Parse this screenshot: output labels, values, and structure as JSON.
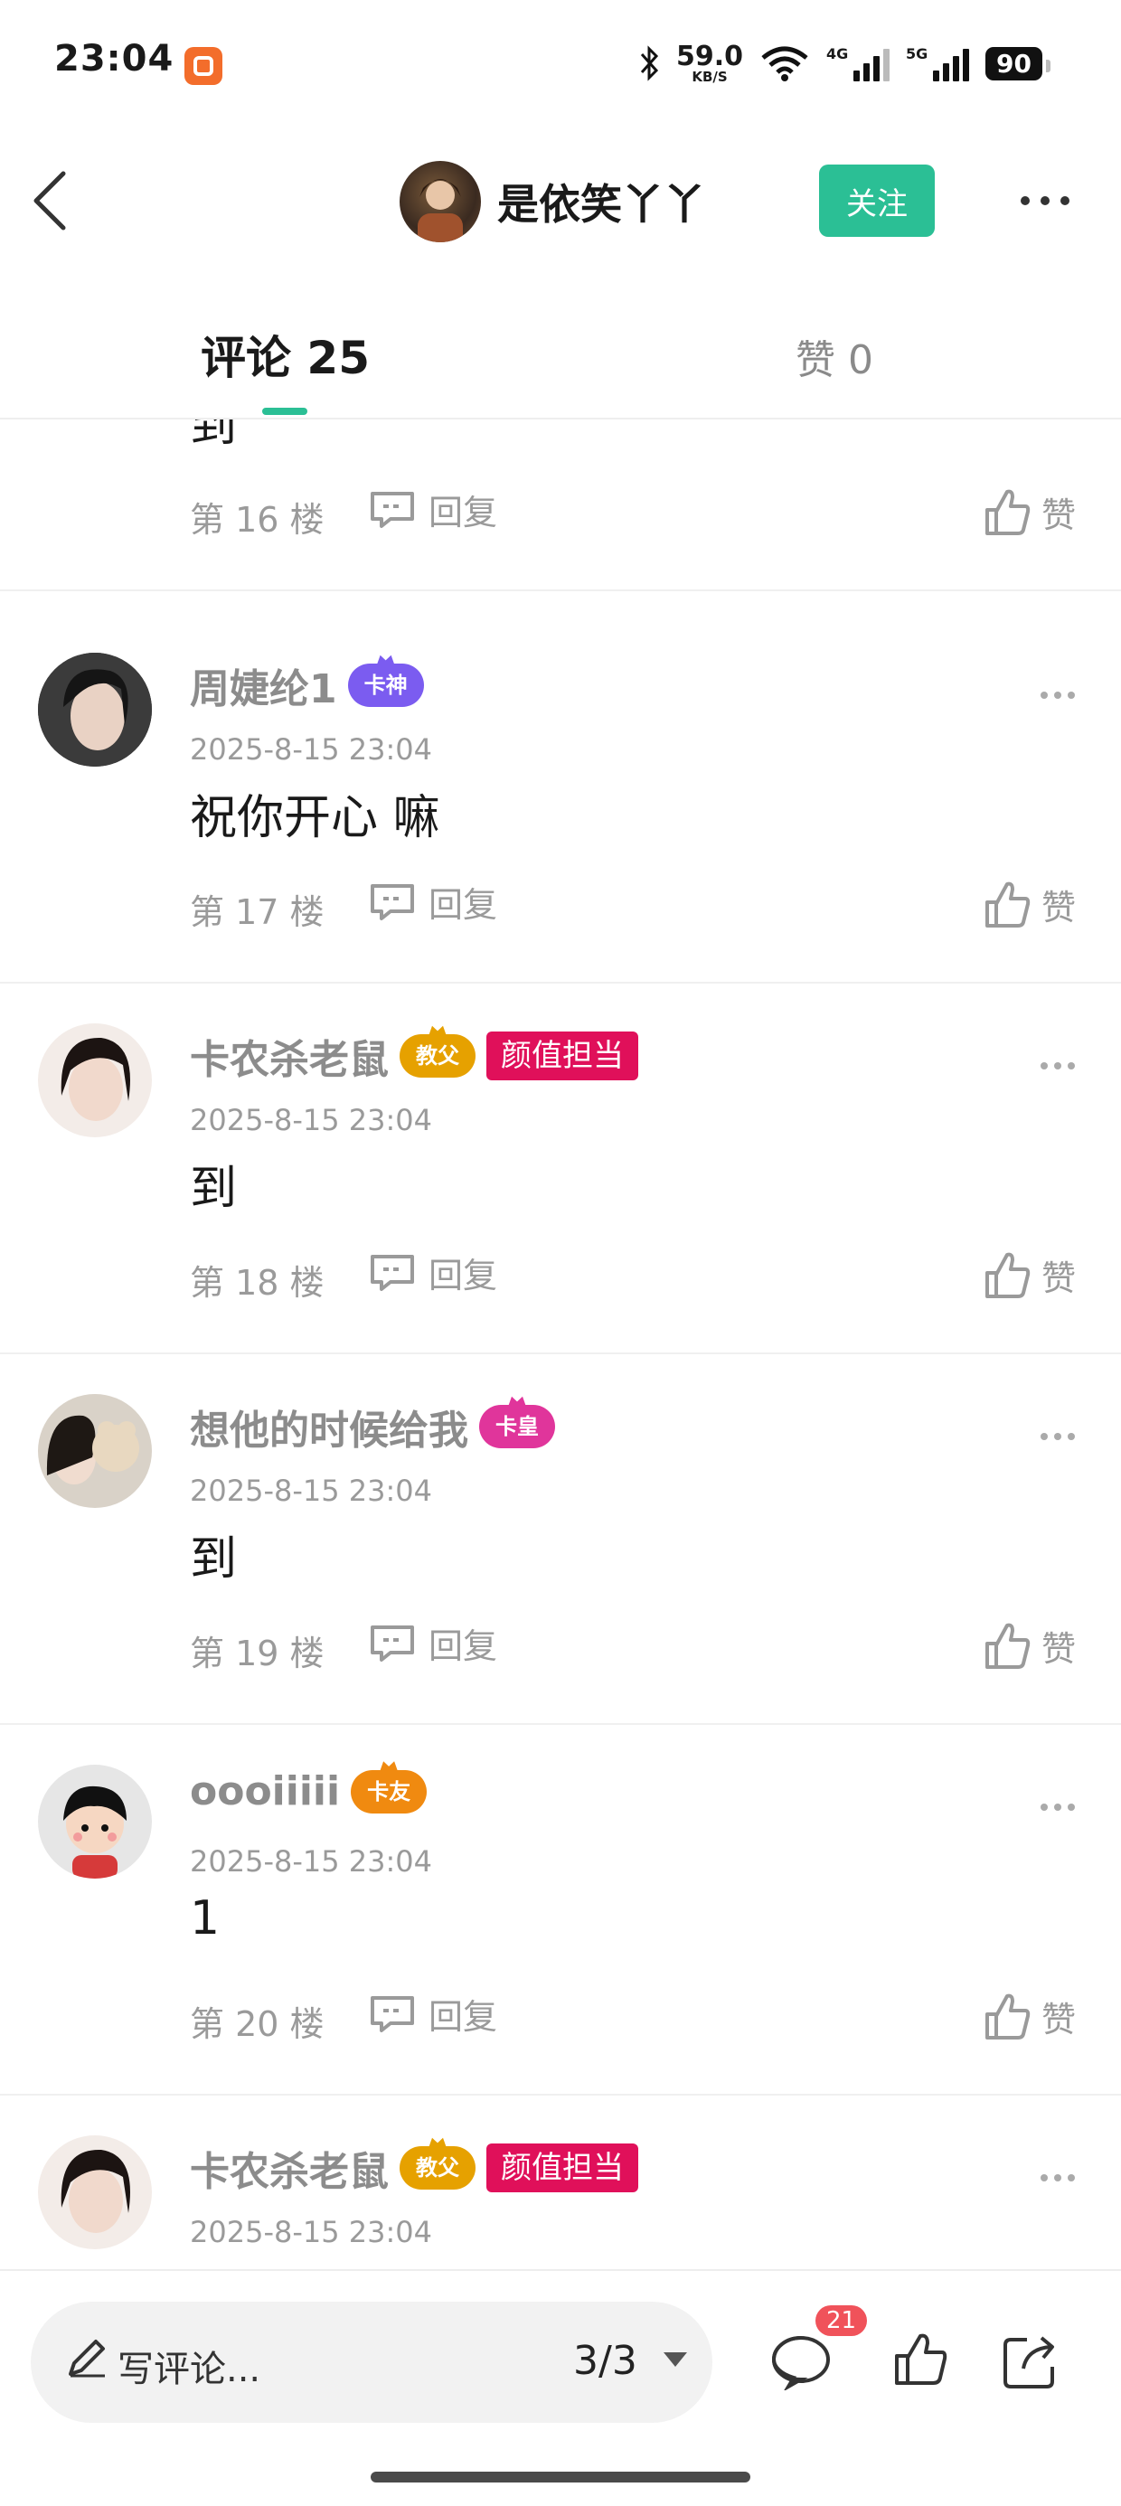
{
  "status_bar": {
    "time": "23:04",
    "net_speed": "59.0",
    "net_unit": "KB/S",
    "sig1_label": "4G",
    "sig2_label": "5G",
    "battery": "90"
  },
  "header": {
    "title": "是依笑丫丫",
    "follow_label": "关注"
  },
  "tabs": {
    "comments": "评论 25",
    "likes": "赞 0"
  },
  "comments": [
    {
      "text": "到",
      "floor": "第 16 楼",
      "reply": "回复",
      "like": "赞"
    },
    {
      "name": "周婕纶1",
      "badge": "卡神",
      "badge_color": "#7b5cf0",
      "time": "2025-8-15 23:04",
      "text": "祝你开心 嘛",
      "floor": "第 17 楼",
      "reply": "回复",
      "like": "赞"
    },
    {
      "name": "卡农杀老鼠",
      "badge": "教父",
      "badge_color": "#e6a100",
      "tag": "颜值担当",
      "time": "2025-8-15 23:04",
      "text": "到",
      "floor": "第 18 楼",
      "reply": "回复",
      "like": "赞"
    },
    {
      "name": "想他的时候给我",
      "badge": "卡皇",
      "badge_color": "#e0359b",
      "time": "2025-8-15 23:04",
      "text": "到",
      "floor": "第 19 楼",
      "reply": "回复",
      "like": "赞"
    },
    {
      "name": "oooiiiii",
      "badge": "卡友",
      "badge_color": "#f08a10",
      "time": "2025-8-15 23:04",
      "text": "1",
      "floor": "第 20 楼",
      "reply": "回复",
      "like": "赞"
    },
    {
      "name": "卡农杀老鼠",
      "badge": "教父",
      "badge_color": "#e6a100",
      "tag": "颜值担当",
      "time": "2025-8-15 23:04"
    }
  ],
  "bottom_bar": {
    "write_placeholder": "写评论...",
    "page_indicator": "3/3",
    "comment_count": "21"
  },
  "colors": {
    "accent": "#2bbf95",
    "tag": "#e0105a",
    "badge_count": "#f0525a"
  }
}
